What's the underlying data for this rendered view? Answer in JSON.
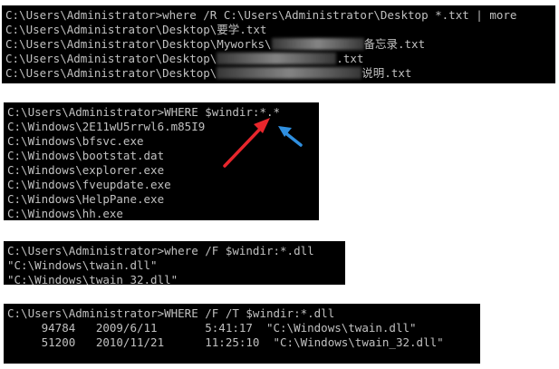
{
  "terminal1": {
    "cmd": "C:\\Users\\Administrator>where /R C:\\Users\\Administrator\\Desktop *.txt | more",
    "line2_pre": "C:\\Users\\Administrator\\Desktop\\",
    "line2_file": "要学.txt",
    "line3_pre": "C:\\Users\\Administrator\\Desktop\\Myworks\\",
    "line3_file": "备忘录.txt",
    "line4_pre": "C:\\Users\\Administrator\\Desktop\\",
    "line4_file": ".txt",
    "line5_pre": "C:\\Users\\Administrator\\Desktop\\",
    "line5_file": "说明.txt"
  },
  "terminal2": {
    "lines": [
      "C:\\Users\\Administrator>WHERE $windir:*.*",
      "C:\\Windows\\2E11wU5rrwl6.m85I9",
      "C:\\Windows\\bfsvc.exe",
      "C:\\Windows\\bootstat.dat",
      "C:\\Windows\\explorer.exe",
      "C:\\Windows\\fveupdate.exe",
      "C:\\Windows\\HelpPane.exe",
      "C:\\Windows\\hh.exe"
    ]
  },
  "terminal3": {
    "lines": [
      "C:\\Users\\Administrator>where /F $windir:*.dll",
      "\"C:\\Windows\\twain.dll\"",
      "\"C:\\Windows\\twain_32.dll\""
    ]
  },
  "terminal4": {
    "lines": [
      "C:\\Users\\Administrator>WHERE /F /T $windir:*.dll",
      "     94784   2009/6/11       5:41:17  \"C:\\Windows\\twain.dll\"",
      "     51200   2010/11/21      11:25:10  \"C:\\Windows\\twain_32.dll\""
    ]
  },
  "colors": {
    "terminal_bg": "#000000",
    "terminal_fg": "#c0c0c0",
    "red_arrow": "#e8262c",
    "blue_arrow": "#2f8fe0"
  }
}
